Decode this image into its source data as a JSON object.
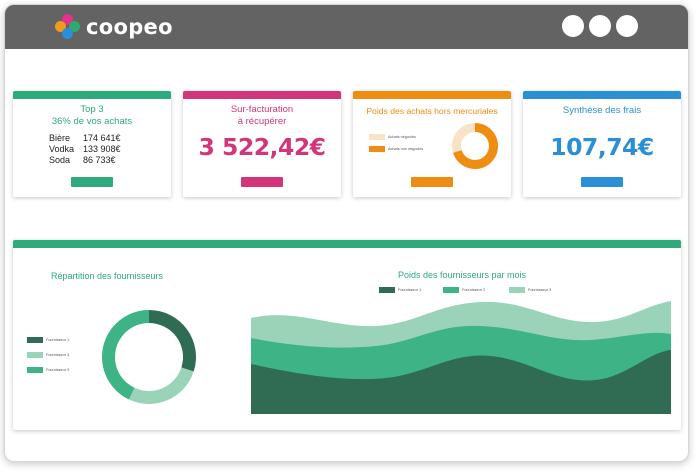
{
  "app": {
    "logo_text": "coopeo",
    "logo_colors": [
      "#e4318a",
      "#f29a1d",
      "#2eaa6d",
      "#2a8fd8"
    ]
  },
  "cards": {
    "top3": {
      "title_line1": "Top 3",
      "title_line2": "36% de vos achats",
      "rows": [
        {
          "name": "Bière",
          "value": "174 641€"
        },
        {
          "name": "Vodka",
          "value": "133 908€"
        },
        {
          "name": "Soda",
          "value": "86 733€"
        }
      ],
      "color": "#2eaa7c"
    },
    "surfact": {
      "title_line1": "Sur-facturation",
      "title_line2": "à récupérer",
      "value": "3 522,42€",
      "color": "#d2357a"
    },
    "poids": {
      "title": "Poids des achats hors mercuriales",
      "legend": [
        "Achats négociés",
        "Achats non négociés"
      ],
      "donut_values": [
        0.3,
        0.7
      ],
      "colors": [
        "#f9e3c6",
        "#ef8d12"
      ],
      "color": "#ef8d12"
    },
    "frais": {
      "title": "Synthèse des frais",
      "value": "107,74€",
      "color": "#2b8fd6"
    }
  },
  "bottom": {
    "bar_color": "#2eaa7c",
    "repartition": {
      "title": "Répartition des fournisseurs",
      "legend": [
        "Fournisseur 1",
        "Fournisseur 3",
        "Fournisseur 3"
      ],
      "legend_colors": [
        "#2f6c53",
        "#9ad3b8",
        "#3db386"
      ],
      "donut_values": [
        0.3,
        0.27,
        0.43
      ],
      "donut_colors": [
        "#2f6c53",
        "#9ad3b8",
        "#3db386"
      ]
    },
    "par_mois": {
      "title": "Poids des fournisseurs par mois",
      "legend": [
        "Fournisseur 1",
        "Fournisseur 2",
        "Fournisseur 3"
      ],
      "legend_colors": [
        "#2f6c53",
        "#3db386",
        "#9ad3b8"
      ]
    }
  }
}
